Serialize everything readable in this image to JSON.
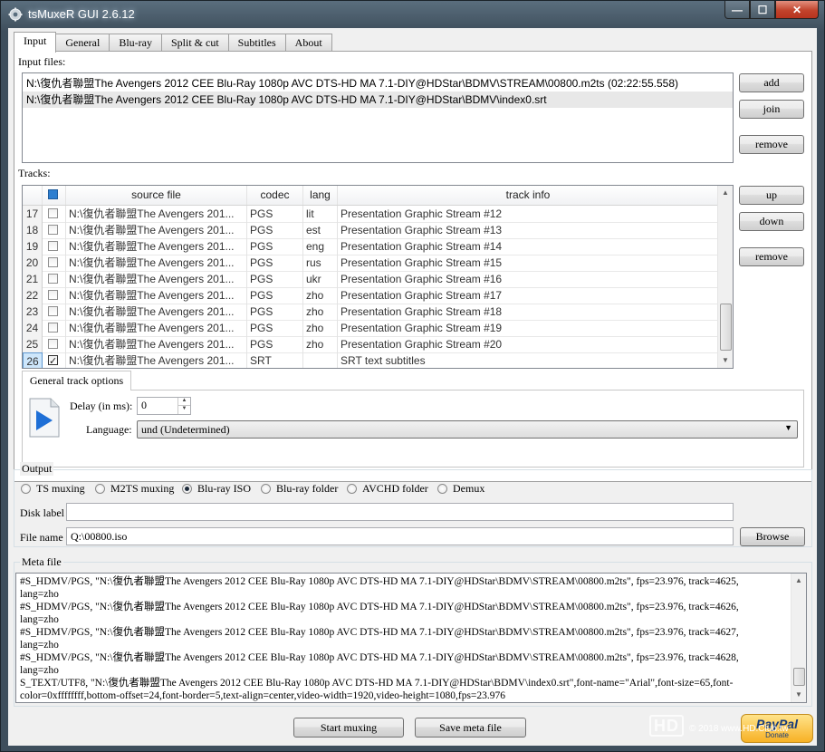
{
  "window": {
    "title": "tsMuxeR GUI 2.6.12",
    "minimize": "—",
    "maximize": "☐",
    "close": "✕"
  },
  "tabs": [
    "Input",
    "General",
    "Blu-ray",
    "Split & cut",
    "Subtitles",
    "About"
  ],
  "input_files": {
    "label": "Input files:",
    "items": [
      "N:\\復仇者聯盟The Avengers 2012 CEE Blu-Ray 1080p AVC DTS-HD MA 7.1-DIY@HDStar\\BDMV\\STREAM\\00800.m2ts (02:22:55.558)",
      "N:\\復仇者聯盟The Avengers 2012 CEE Blu-Ray 1080p AVC DTS-HD MA 7.1-DIY@HDStar\\BDMV\\index0.srt"
    ],
    "buttons": {
      "add": "add",
      "join": "join",
      "remove": "remove"
    }
  },
  "tracks": {
    "label": "Tracks:",
    "columns": {
      "source": "source file",
      "codec": "codec",
      "lang": "lang",
      "info": "track info"
    },
    "rows": [
      {
        "num": "17",
        "checked": false,
        "source": "N:\\復仇者聯盟The Avengers 201...",
        "codec": "PGS",
        "lang": "lit",
        "info": "Presentation Graphic Stream #12"
      },
      {
        "num": "18",
        "checked": false,
        "source": "N:\\復仇者聯盟The Avengers 201...",
        "codec": "PGS",
        "lang": "est",
        "info": "Presentation Graphic Stream #13"
      },
      {
        "num": "19",
        "checked": false,
        "source": "N:\\復仇者聯盟The Avengers 201...",
        "codec": "PGS",
        "lang": "eng",
        "info": "Presentation Graphic Stream #14"
      },
      {
        "num": "20",
        "checked": false,
        "source": "N:\\復仇者聯盟The Avengers 201...",
        "codec": "PGS",
        "lang": "rus",
        "info": "Presentation Graphic Stream #15"
      },
      {
        "num": "21",
        "checked": false,
        "source": "N:\\復仇者聯盟The Avengers 201...",
        "codec": "PGS",
        "lang": "ukr",
        "info": "Presentation Graphic Stream #16"
      },
      {
        "num": "22",
        "checked": false,
        "source": "N:\\復仇者聯盟The Avengers 201...",
        "codec": "PGS",
        "lang": "zho",
        "info": "Presentation Graphic Stream #17"
      },
      {
        "num": "23",
        "checked": false,
        "source": "N:\\復仇者聯盟The Avengers 201...",
        "codec": "PGS",
        "lang": "zho",
        "info": "Presentation Graphic Stream #18"
      },
      {
        "num": "24",
        "checked": false,
        "source": "N:\\復仇者聯盟The Avengers 201...",
        "codec": "PGS",
        "lang": "zho",
        "info": "Presentation Graphic Stream #19"
      },
      {
        "num": "25",
        "checked": false,
        "source": "N:\\復仇者聯盟The Avengers 201...",
        "codec": "PGS",
        "lang": "zho",
        "info": "Presentation Graphic Stream #20"
      },
      {
        "num": "26",
        "checked": true,
        "source": "N:\\復仇者聯盟The Avengers 201...",
        "codec": "SRT",
        "lang": "",
        "info": "SRT text subtitles"
      }
    ],
    "buttons": {
      "up": "up",
      "down": "down",
      "remove": "remove"
    }
  },
  "track_options": {
    "tab": "General track options",
    "delay_label": "Delay (in ms):",
    "delay_value": "0",
    "language_label": "Language:",
    "language_value": "und (Undetermined)"
  },
  "output": {
    "label": "Output",
    "modes": [
      {
        "label": "TS muxing",
        "selected": false
      },
      {
        "label": "M2TS muxing",
        "selected": false
      },
      {
        "label": "Blu-ray ISO",
        "selected": true
      },
      {
        "label": "Blu-ray folder",
        "selected": false
      },
      {
        "label": "AVCHD folder",
        "selected": false
      },
      {
        "label": "Demux",
        "selected": false
      }
    ],
    "disk_label": "Disk label",
    "disk_value": "",
    "file_name_label": "File name",
    "file_name_value": "Q:\\00800.iso",
    "browse": "Browse"
  },
  "meta": {
    "label": "Meta file",
    "lines": [
      "#S_HDMV/PGS, \"N:\\復仇者聯盟The Avengers 2012 CEE Blu-Ray 1080p AVC DTS-HD MA 7.1-DIY@HDStar\\BDMV\\STREAM\\00800.m2ts\", fps=23.976, track=4625,",
      "lang=zho",
      "#S_HDMV/PGS, \"N:\\復仇者聯盟The Avengers 2012 CEE Blu-Ray 1080p AVC DTS-HD MA 7.1-DIY@HDStar\\BDMV\\STREAM\\00800.m2ts\", fps=23.976, track=4626,",
      "lang=zho",
      "#S_HDMV/PGS, \"N:\\復仇者聯盟The Avengers 2012 CEE Blu-Ray 1080p AVC DTS-HD MA 7.1-DIY@HDStar\\BDMV\\STREAM\\00800.m2ts\", fps=23.976, track=4627,",
      "lang=zho",
      "#S_HDMV/PGS, \"N:\\復仇者聯盟The Avengers 2012 CEE Blu-Ray 1080p AVC DTS-HD MA 7.1-DIY@HDStar\\BDMV\\STREAM\\00800.m2ts\", fps=23.976, track=4628,",
      "lang=zho",
      "S_TEXT/UTF8, \"N:\\復仇者聯盟The Avengers 2012 CEE Blu-Ray 1080p AVC DTS-HD MA 7.1-DIY@HDStar\\BDMV\\index0.srt\",font-name=\"Arial\",font-size=65,font-",
      "color=0xffffffff,bottom-offset=24,font-border=5,text-align=center,video-width=1920,video-height=1080,fps=23.976"
    ]
  },
  "actions": {
    "start": "Start muxing",
    "save_meta": "Save meta file"
  },
  "paypal": {
    "brand": "PayPal",
    "donate": "Donate"
  },
  "watermark": {
    "logo": "HD",
    "text": "© 2018 www.HD.Club.tw"
  }
}
